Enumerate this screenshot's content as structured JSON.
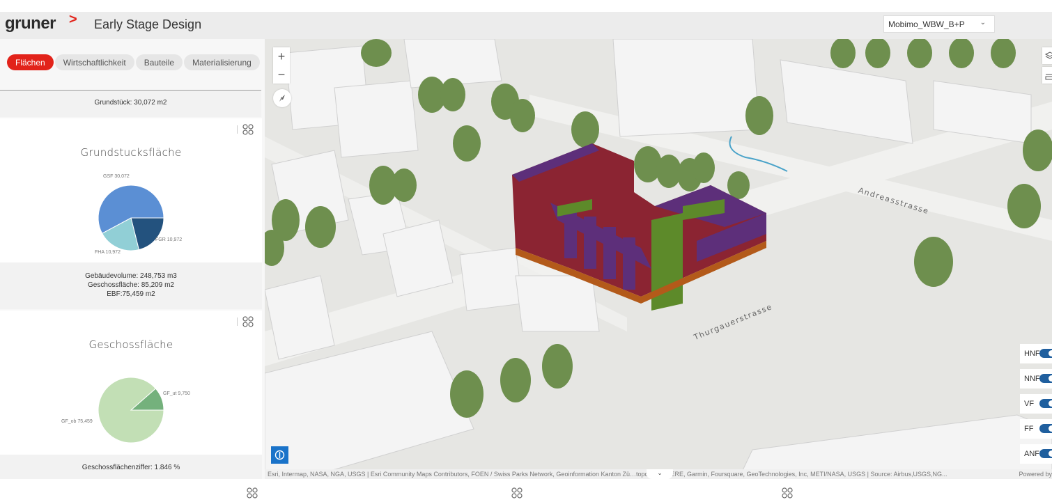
{
  "header": {
    "logo": "gruner",
    "logo_mark": ">",
    "app_title": "Early Stage Design",
    "scenario_select": {
      "value": "Mobimo_WBW_B+P",
      "icon": "chevron-down-icon"
    }
  },
  "sidebar": {
    "tabs": [
      {
        "label": "Flächen",
        "active": true
      },
      {
        "label": "Wirtschaftlichkeit",
        "active": false
      },
      {
        "label": "Bauteile",
        "active": false
      },
      {
        "label": "Materialisierung",
        "active": false
      }
    ],
    "grundstueck_summary": "Grundstück: 30,072 m2",
    "cards": [
      {
        "title": "Grundstucksfläche",
        "menu_icon": "grid-menu-icon",
        "footer_lines": [
          "Gebäudevolume: 248,753  m3",
          "Geschossfläche: 85,209  m2",
          "EBF:75,459  m2"
        ]
      },
      {
        "title": "Geschossfläche",
        "menu_icon": "grid-menu-icon",
        "footer_lines": [
          "Geschossflächenziffer: 1.846  %"
        ]
      }
    ]
  },
  "chart_data": [
    {
      "type": "pie",
      "title": "Grundstucksfläche",
      "slices": [
        {
          "label": "GSF",
          "value": 30072,
          "display": "GSF 30,072",
          "color": "#5b8fd4"
        },
        {
          "label": "FGR",
          "value": 10972,
          "display": "FGR 10,972",
          "color": "#23527e"
        },
        {
          "label": "FHA",
          "value": 10972,
          "display": "FHA 10,972",
          "color": "#91cfd6"
        }
      ]
    },
    {
      "type": "pie",
      "title": "Geschossfläche",
      "slices": [
        {
          "label": "GF_ut",
          "value": 9750,
          "display": "GF_ut 9,750",
          "color": "#74b17c"
        },
        {
          "label": "GF_ob",
          "value": 75459,
          "display": "GF_ob 75,459",
          "color": "#c2dfb5"
        }
      ]
    }
  ],
  "map": {
    "zoom_in": "+",
    "zoom_out": "−",
    "compass_icon": "compass-icon",
    "info_icon": "info-icon",
    "right_tools": [
      "layers-icon",
      "measure-icon"
    ],
    "street_labels": [
      "Thurgauerstrasse",
      "Andreasstrasse"
    ],
    "layer_toggles": [
      {
        "label": "HNF",
        "on": true
      },
      {
        "label": "NNF",
        "on": true
      },
      {
        "label": "VF",
        "on": true
      },
      {
        "label": "FF",
        "on": true
      },
      {
        "label": "ANF",
        "on": true
      }
    ],
    "building_colors": {
      "hnf": "#8b2432",
      "nnf": "#5d2f7a",
      "vf": "#5d8a2a",
      "ff": "#b35a1a"
    },
    "attribution": "Esri, Intermap, NASA, NGA, USGS | Esri Community Maps Contributors, FOEN / Swiss Parks Network, Geoinformation Kanton Zü…topo, Esri, HERE, Garmin, Foursquare, GeoTechnologies, Inc, METI/NASA, USGS | Source: Airbus,USGS,NG...",
    "attribution_toggle": "⌄",
    "powered_by": "Powered by"
  },
  "bottom_panels": {
    "menu_icon": "grid-menu-icon"
  }
}
